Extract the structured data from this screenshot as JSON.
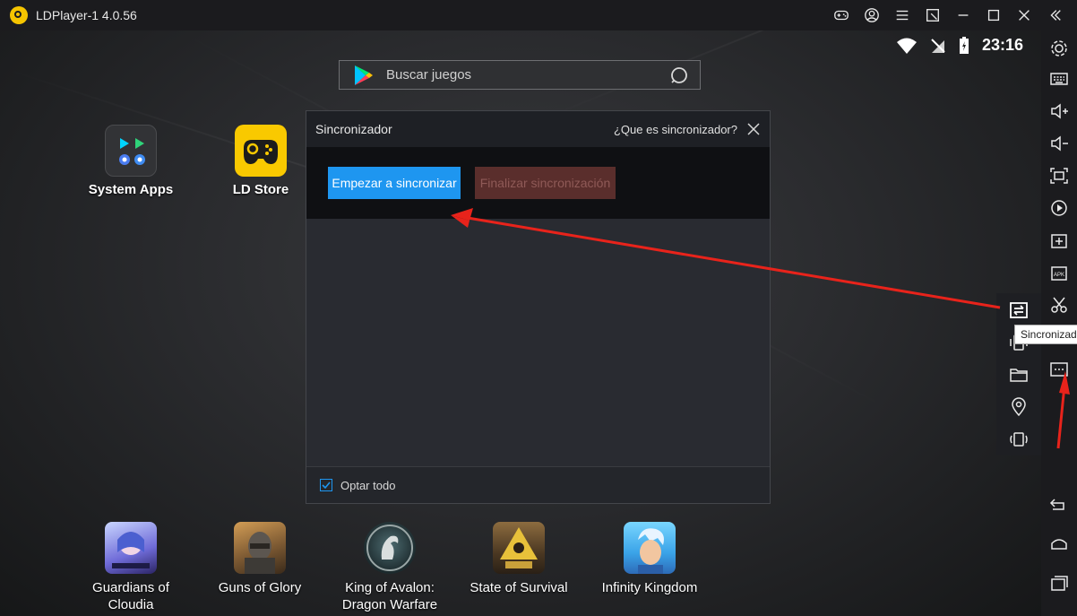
{
  "window": {
    "title": "LDPlayer-1 4.0.56"
  },
  "status": {
    "time": "23:16"
  },
  "search": {
    "placeholder": "Buscar juegos"
  },
  "desktop": {
    "apps": [
      {
        "label": "System Apps"
      },
      {
        "label": "LD Store"
      }
    ],
    "games": [
      {
        "label_line1": "Guardians of",
        "label_line2": "Cloudia"
      },
      {
        "label_line1": "Guns of Glory",
        "label_line2": ""
      },
      {
        "label_line1": "King of Avalon:",
        "label_line2": "Dragon Warfare"
      },
      {
        "label_line1": "State of Survival",
        "label_line2": ""
      },
      {
        "label_line1": "Infinity Kingdom",
        "label_line2": ""
      }
    ]
  },
  "dialog": {
    "title": "Sincronizador",
    "help_link": "¿Que es sincronizador?",
    "start_button": "Empezar a sincronizar",
    "stop_button": "Finalizar sincronización",
    "select_all_label": "Optar todo",
    "select_all_checked": true
  },
  "tooltip": {
    "text": "Sincronizador"
  },
  "colors": {
    "accent": "#1e96f0",
    "stop_button_bg": "#5a2e2c",
    "annotation_arrow": "#e8231b",
    "ld_yellow": "#f9c900"
  },
  "icons": {
    "titlebar": [
      "gamepad-icon",
      "account-icon",
      "menu-icon",
      "shrink-icon",
      "minimize-icon",
      "maximize-icon",
      "close-icon",
      "collapse-icon"
    ],
    "sidebar": [
      "settings-icon",
      "keyboard-icon",
      "volume-up-icon",
      "volume-down-icon",
      "screenshot-icon",
      "record-icon",
      "add-app-icon",
      "apk-icon",
      "scissors-icon",
      "more-icon",
      "back-icon",
      "home-icon",
      "recents-icon"
    ],
    "flyout": [
      "sync-icon",
      "shake-icon",
      "folder-icon",
      "location-icon",
      "rotate-icon"
    ]
  }
}
